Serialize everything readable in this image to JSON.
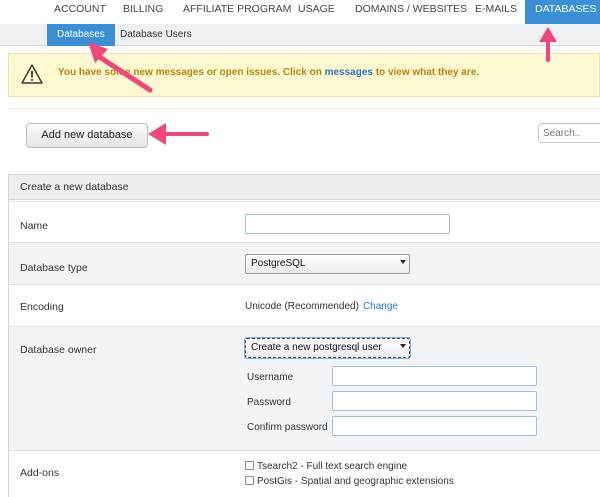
{
  "topnav": {
    "items": [
      "ACCOUNT",
      "BILLING",
      "AFFILIATE PROGRAM",
      "USAGE",
      "DOMAINS / WEBSITES",
      "E-MAILS",
      "DATABASES"
    ],
    "active_index": 6
  },
  "subnav": {
    "items": [
      "Databases",
      "Database Users"
    ],
    "active_index": 0
  },
  "alert": {
    "text_before": "You have some new messages or open issues. Click on ",
    "link": "messages",
    "text_after": " to view what they are."
  },
  "toolbar": {
    "add_button": "Add new database",
    "search_placeholder": "Search.."
  },
  "form": {
    "title": "Create a new database",
    "name_label": "Name",
    "name_value": "",
    "type_label": "Database type",
    "type_value": "PostgreSQL",
    "encoding_label": "Encoding",
    "encoding_value": "Unicode (Recommended)",
    "encoding_change": "Change",
    "owner_label": "Database owner",
    "owner_value": "Create a new postgresql user",
    "username_label": "Username",
    "password_label": "Password",
    "confirm_label": "Confirm password",
    "addons_label": "Add-ons",
    "addons": [
      "Tsearch2 - Full text search engine",
      "PostGis - Spatial and geographic extensions"
    ]
  },
  "colors": {
    "accent": "#3a8fd6",
    "annotation_arrow": "#f0467a",
    "warning_bg": "#fdf7d2",
    "warning_text": "#b8860b",
    "link": "#2a76c6"
  }
}
